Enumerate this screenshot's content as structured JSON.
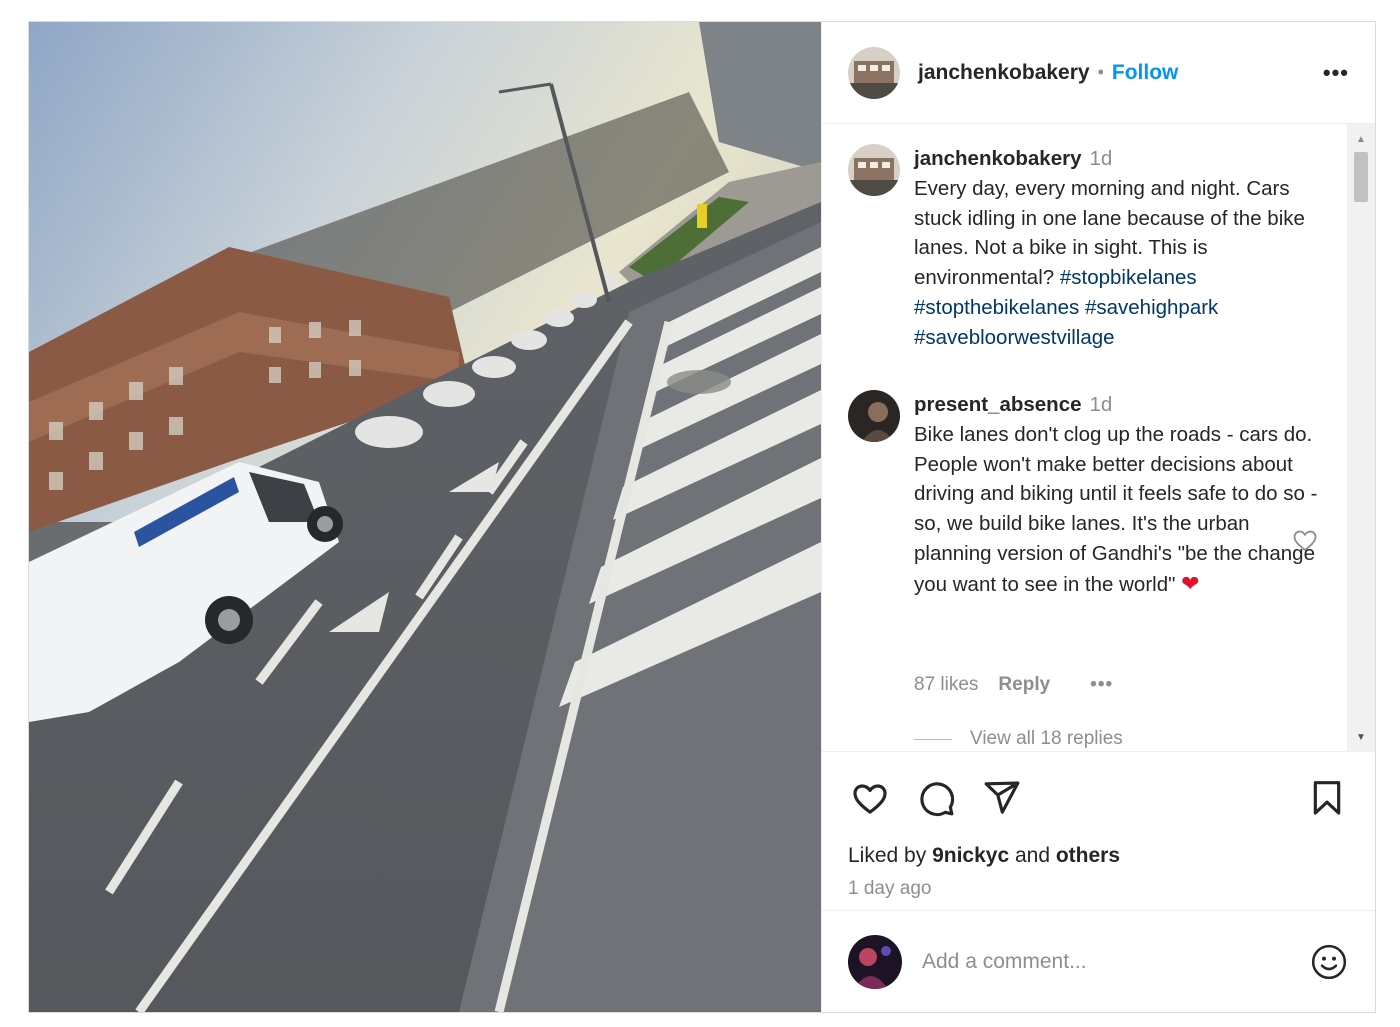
{
  "post": {
    "author": "janchenkobakery",
    "follow_label": "Follow",
    "more_label": "•••",
    "separator": "•"
  },
  "caption": {
    "username": "janchenkobakery",
    "time": "1d",
    "text": "Every day, every morning and night. Cars stuck idling in one lane because of the bike lanes. Not a bike in sight. This is environmental? ",
    "hashtags": [
      "#stopbikelanes",
      "#stopthebikelanes",
      "#savehighpark",
      "#savebloorwestvillage"
    ]
  },
  "comment": {
    "username": "present_absence",
    "time": "1d",
    "text": "Bike lanes don't clog up the roads - cars do. People won't make better decisions about driving and biking until it feels safe to do so - so, we build bike lanes. It's the urban planning version of Gandhi's \"be the change you want to see in the world\" ",
    "emoji": "❤",
    "likes": "87 likes",
    "reply_label": "Reply",
    "more_label": "•••",
    "view_replies": "View all 18 replies"
  },
  "engagement": {
    "liked_by_prefix": "Liked by",
    "liked_by_user": "9nickyc",
    "liked_by_and": "and",
    "liked_by_others": "others",
    "time_ago": "1 day ago"
  },
  "add_comment": {
    "placeholder": "Add a comment..."
  },
  "icons": {
    "like": "heart-icon",
    "comment": "comment-icon",
    "share": "share-icon",
    "save": "bookmark-icon",
    "emoji": "smile-icon"
  },
  "colors": {
    "accent": "#0095f6",
    "hashtag": "#00376b",
    "muted": "#8e8e8e"
  }
}
